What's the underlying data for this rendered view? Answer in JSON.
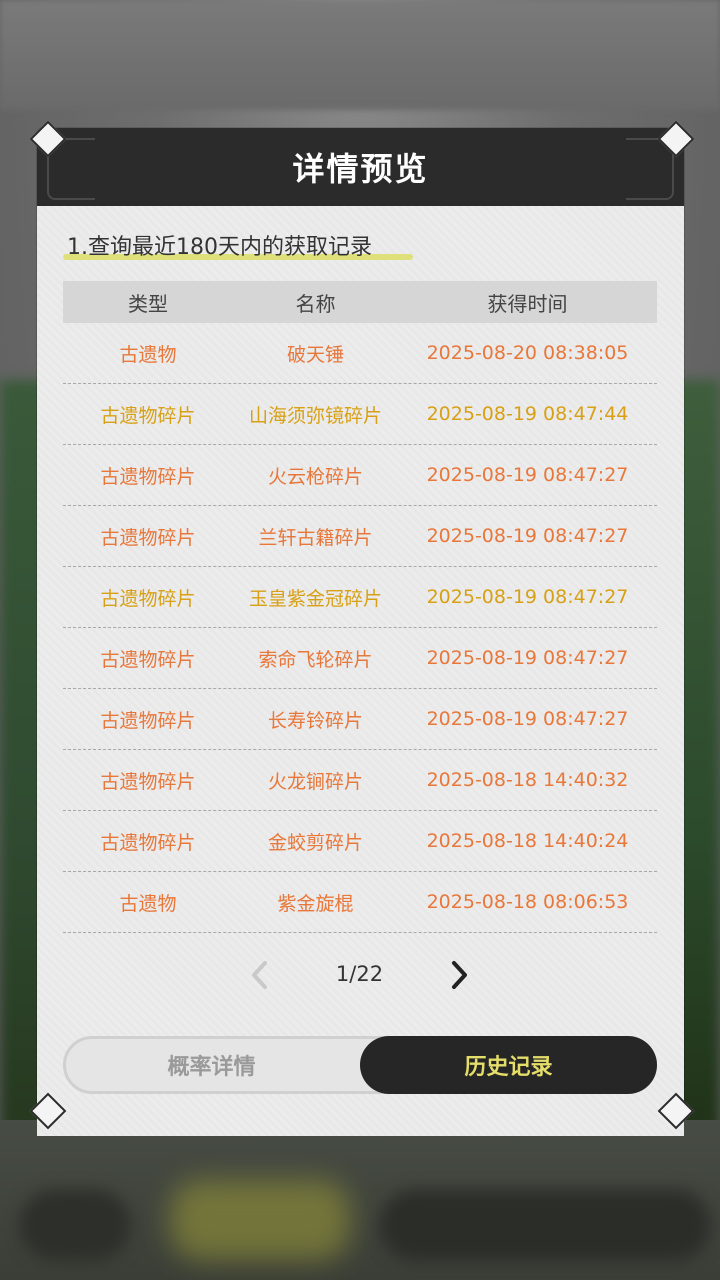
{
  "dialog": {
    "title": "详情预览",
    "section_title": "1.查询最近180天内的获取记录"
  },
  "table": {
    "headers": {
      "type": "类型",
      "name": "名称",
      "time": "获得时间"
    },
    "rows": [
      {
        "type": "古遗物",
        "name": "破天锤",
        "time": "2025-08-20 08:38:05",
        "color": "#e8773a"
      },
      {
        "type": "古遗物碎片",
        "name": "山海须弥镜碎片",
        "time": "2025-08-19 08:47:44",
        "color": "#d8a015"
      },
      {
        "type": "古遗物碎片",
        "name": "火云枪碎片",
        "time": "2025-08-19 08:47:27",
        "color": "#e8773a"
      },
      {
        "type": "古遗物碎片",
        "name": "兰轩古籍碎片",
        "time": "2025-08-19 08:47:27",
        "color": "#e8773a"
      },
      {
        "type": "古遗物碎片",
        "name": "玉皇紫金冠碎片",
        "time": "2025-08-19 08:47:27",
        "color": "#d8a015"
      },
      {
        "type": "古遗物碎片",
        "name": "索命飞轮碎片",
        "time": "2025-08-19 08:47:27",
        "color": "#e8773a"
      },
      {
        "type": "古遗物碎片",
        "name": "长寿铃碎片",
        "time": "2025-08-19 08:47:27",
        "color": "#e8773a"
      },
      {
        "type": "古遗物碎片",
        "name": "火龙锏碎片",
        "time": "2025-08-18 14:40:32",
        "color": "#e8773a"
      },
      {
        "type": "古遗物碎片",
        "name": "金蛟剪碎片",
        "time": "2025-08-18 14:40:24",
        "color": "#e8773a"
      },
      {
        "type": "古遗物",
        "name": "紫金旋棍",
        "time": "2025-08-18 08:06:53",
        "color": "#e8773a"
      }
    ]
  },
  "pager": {
    "text": "1/22",
    "prev_icon": "chevron-left-icon",
    "next_icon": "chevron-right-icon"
  },
  "tabs": {
    "probability": "概率详情",
    "history": "历史记录",
    "active": "history"
  },
  "colors": {
    "header_bg": "#2b2b2b",
    "orange": "#e8773a",
    "gold": "#d8a015",
    "tab_active_text": "#e5dd6a",
    "underline": "#dfe07a"
  }
}
